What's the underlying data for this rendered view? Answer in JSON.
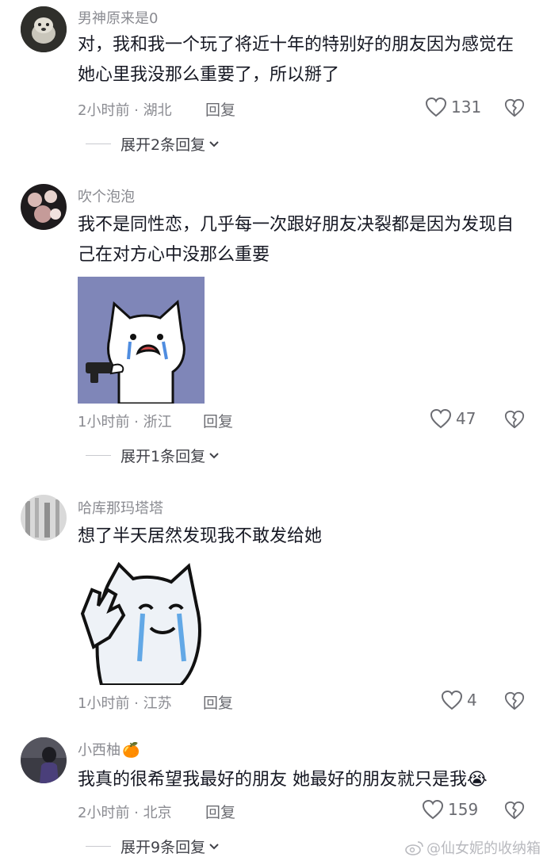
{
  "comments": [
    {
      "username": "男神原来是0",
      "text": "对，我和我一个玩了将近十年的特别好的朋友因为感觉在她心里我没那么重要了，所以掰了",
      "time_location": "2小时前 · 湖北",
      "reply_label": "回复",
      "likes": "131",
      "expand_label": "展开2条回复"
    },
    {
      "username": "吹个泡泡",
      "text": "我不是同性恋，几乎每一次跟好朋友决裂都是因为发现自己在对方心中没那么重要",
      "time_location": "1小时前 · 浙江",
      "reply_label": "回复",
      "likes": "47",
      "expand_label": "展开1条回复"
    },
    {
      "username": "哈库那玛塔塔",
      "text": "想了半天居然发现我不敢发给她",
      "time_location": "1小时前 · 江苏",
      "reply_label": "回复",
      "likes": "4"
    },
    {
      "username": "小西柚",
      "username_emoji": "🍊",
      "text": "我真的很希望我最好的朋友 她最好的朋友就只是我😭",
      "time_location": "2小时前 · 北京",
      "reply_label": "回复",
      "likes": "159",
      "expand_label": "展开9条回复"
    }
  ],
  "watermark": "@仙女妮的收纳箱",
  "colors": {
    "text": "#161823",
    "meta": "#8a8b91",
    "sticker_bg_1": "#7f86b8"
  }
}
